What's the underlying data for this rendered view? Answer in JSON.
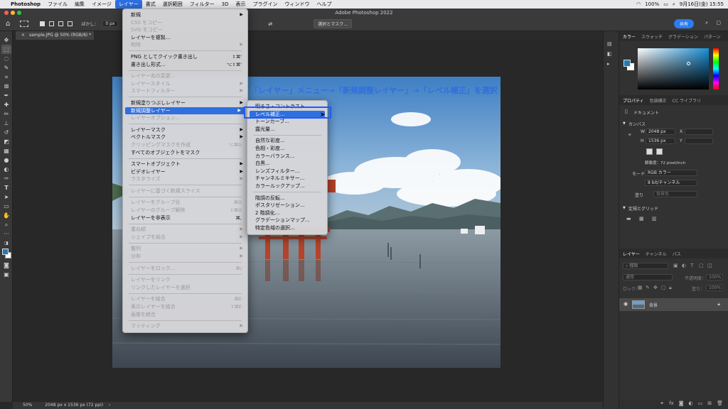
{
  "menubar": {
    "apple": "",
    "app": "Photoshop",
    "items": [
      "ファイル",
      "編集",
      "イメージ",
      "レイヤー",
      "書式",
      "選択範囲",
      "フィルター",
      "3D",
      "表示",
      "プラグイン",
      "ウィンドウ",
      "ヘルプ"
    ],
    "active_index": 3,
    "battery": "100%",
    "clock": "9月16日(金) 15:55"
  },
  "window": {
    "title": "Adobe Photoshop 2022"
  },
  "options": {
    "feather_label": "ぼかし：",
    "feather_value": "0 px",
    "mask_button": "選択とマスク...",
    "share": "共有"
  },
  "document": {
    "tab": "sample.JPG @ 50% (RGB/8) *",
    "close": "×"
  },
  "status": {
    "zoom": "50%",
    "info": "2048 px x 1536 px (72 ppi)"
  },
  "caption": "「レイヤー」メニュー→「新規調整レイヤー」→「レベル補正」を選択",
  "layer_menu": [
    {
      "label": "新規",
      "arrow": "▶"
    },
    {
      "label": "CSS をコピー",
      "dis": true
    },
    {
      "label": "SVG をコピー",
      "dis": true
    },
    {
      "label": "レイヤーを複製..."
    },
    {
      "label": "削除",
      "arrow": "▶",
      "dis": true
    },
    {
      "sep": true
    },
    {
      "label": "PNG としてクイック書き出し",
      "sc": "⇧⌘'"
    },
    {
      "label": "書き出し形式...",
      "sc": "⌥⇧⌘'"
    },
    {
      "sep": true
    },
    {
      "label": "レイヤー名の変更...",
      "dis": true
    },
    {
      "label": "レイヤースタイル",
      "arrow": "▶",
      "dis": true
    },
    {
      "label": "スマートフィルター",
      "arrow": "▶",
      "dis": true
    },
    {
      "sep": true
    },
    {
      "label": "新規塗りつぶしレイヤー",
      "arrow": "▶"
    },
    {
      "label": "新規調整レイヤー",
      "arrow": "▶",
      "hl": true
    },
    {
      "label": "レイヤーオプション...",
      "dis": true
    },
    {
      "sep": true
    },
    {
      "label": "レイヤーマスク",
      "arrow": "▶"
    },
    {
      "label": "ベクトルマスク",
      "arrow": "▶"
    },
    {
      "label": "クリッピングマスクを作成",
      "sc": "⌥⌘G",
      "dis": true
    },
    {
      "label": "すべてのオブジェクトをマスク"
    },
    {
      "sep": true
    },
    {
      "label": "スマートオブジェクト",
      "arrow": "▶"
    },
    {
      "label": "ビデオレイヤー",
      "arrow": "▶"
    },
    {
      "label": "ラスタライズ",
      "arrow": "▶",
      "dis": true
    },
    {
      "sep": true
    },
    {
      "label": "レイヤーに基づく新規スライス",
      "dis": true
    },
    {
      "sep": true
    },
    {
      "label": "レイヤーをグループ化",
      "sc": "⌘G",
      "dis": true
    },
    {
      "label": "レイヤーのグループ解除",
      "sc": "⇧⌘G",
      "dis": true
    },
    {
      "label": "レイヤーを非表示",
      "sc": "⌘,"
    },
    {
      "sep": true
    },
    {
      "label": "重ね順",
      "arrow": "▶",
      "dis": true
    },
    {
      "label": "シェイプを結合",
      "arrow": "▶",
      "dis": true
    },
    {
      "sep": true
    },
    {
      "label": "整列",
      "arrow": "▶",
      "dis": true
    },
    {
      "label": "分布",
      "arrow": "▶",
      "dis": true
    },
    {
      "sep": true
    },
    {
      "label": "レイヤーをロック...",
      "sc": "⌘/",
      "dis": true
    },
    {
      "sep": true
    },
    {
      "label": "レイヤーをリンク",
      "dis": true
    },
    {
      "label": "リンクしたレイヤーを選択",
      "dis": true
    },
    {
      "sep": true
    },
    {
      "label": "レイヤーを結合",
      "sc": "⌘E",
      "dis": true
    },
    {
      "label": "表示レイヤーを結合",
      "sc": "⇧⌘E",
      "dis": true
    },
    {
      "label": "画像を統合",
      "dis": true
    },
    {
      "sep": true
    },
    {
      "label": "マッティング",
      "arrow": "▶",
      "dis": true
    }
  ],
  "adjust_menu": [
    {
      "label": "明るさ・コントラスト..."
    },
    {
      "label": "レベル補正...",
      "hl": true
    },
    {
      "label": "トーンカーブ..."
    },
    {
      "label": "露光量..."
    },
    {
      "sep": true
    },
    {
      "label": "自然な彩度..."
    },
    {
      "label": "色相・彩度..."
    },
    {
      "label": "カラーバランス..."
    },
    {
      "label": "白黒..."
    },
    {
      "label": "レンズフィルター..."
    },
    {
      "label": "チャンネルミキサー..."
    },
    {
      "label": "カラールックアップ..."
    },
    {
      "sep": true
    },
    {
      "label": "階調の反転..."
    },
    {
      "label": "ポスタリゼーション..."
    },
    {
      "label": "2 階調化..."
    },
    {
      "label": "グラデーションマップ..."
    },
    {
      "label": "特定色域の選択..."
    }
  ],
  "panels": {
    "color_tabs": [
      "カラー",
      "スウォッチ",
      "グラデーション",
      "パターン"
    ],
    "props_tabs": [
      "プロパティ",
      "色調補正",
      "CC ライブラリ"
    ],
    "doc_label": "ドキュメント",
    "canvas_label": "カンバス",
    "w_label": "W",
    "w_value": "2048 px",
    "h_label": "H",
    "h_value": "1536 px",
    "x_label": "X",
    "y_label": "Y",
    "resolution": "解像度：72 pixel/inch",
    "mode_label": "モード",
    "mode_value": "RGB カラー",
    "depth_value": "8 bit/チャンネル",
    "fill_label": "塗り",
    "fill_value": "背景色",
    "rulers_label": "定規とグリッド",
    "layers_tabs": [
      "レイヤー",
      "チャンネル",
      "パス"
    ],
    "kind": "種類",
    "blend": "通常",
    "opacity_label": "不透明度：",
    "opacity_value": "100%",
    "lock_label": "ロック：",
    "fill2_label": "塗り：",
    "fill2_value": "100%",
    "layer_name": "背景"
  },
  "colors": {
    "accent": "#2f6fe0",
    "foreground": "#1f7bb4",
    "background": "#ffffff"
  }
}
